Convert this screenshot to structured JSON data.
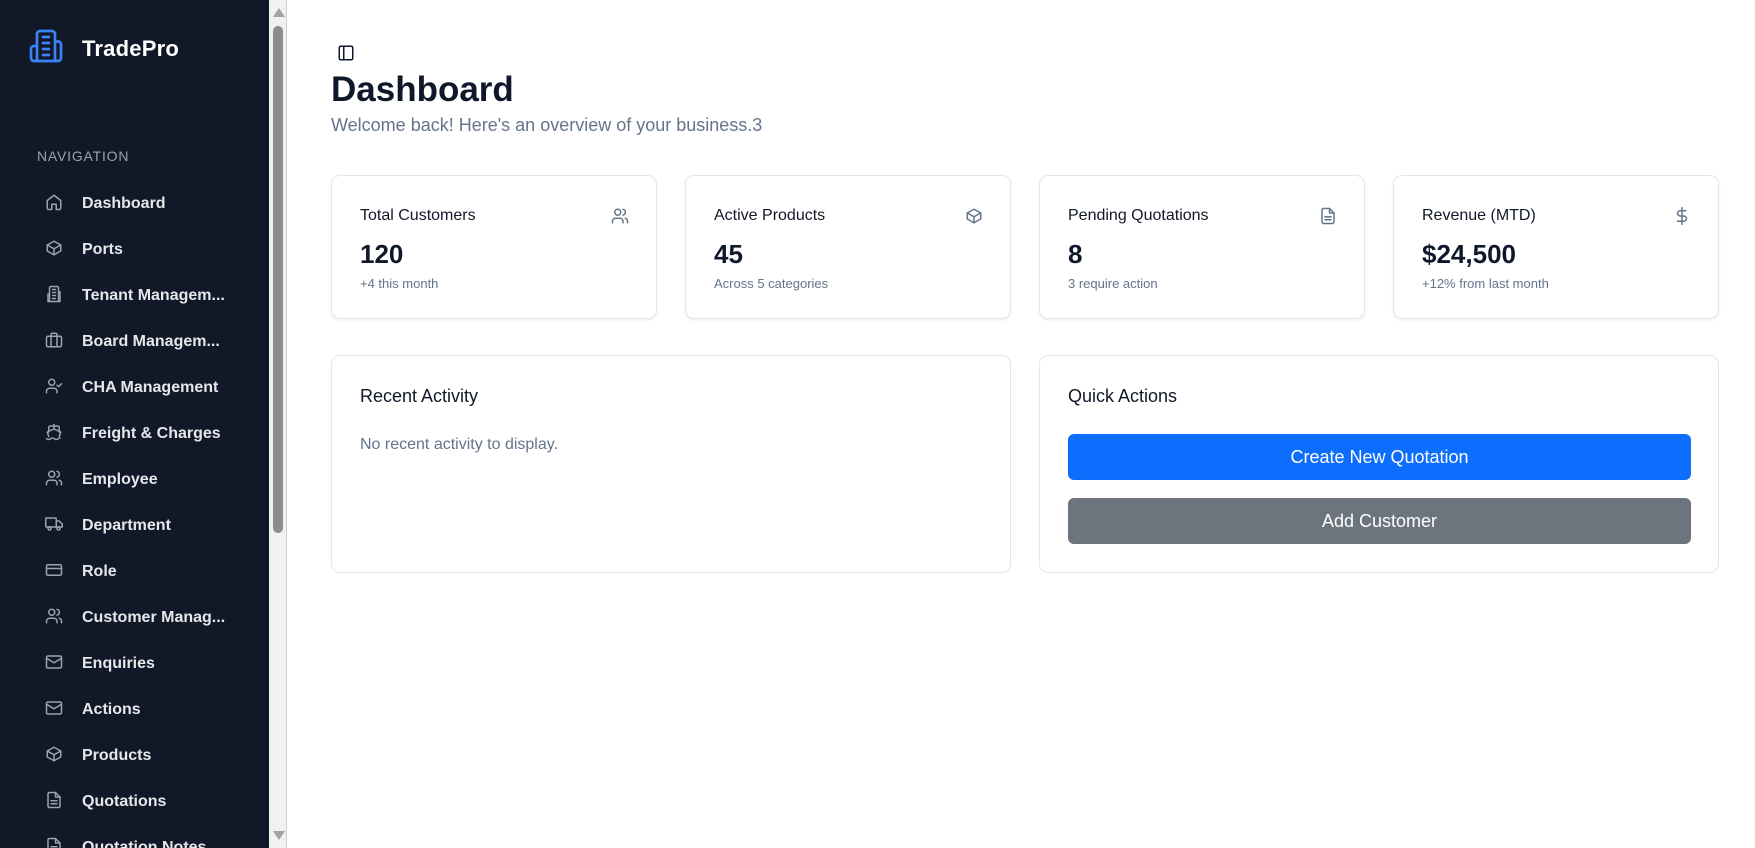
{
  "brand": {
    "name": "TradePro",
    "icon": "building-icon",
    "accent": "#3b82f6"
  },
  "sidebar": {
    "heading": "NAVIGATION",
    "items": [
      {
        "label": "Dashboard",
        "icon": "home-icon"
      },
      {
        "label": "Ports",
        "icon": "package-icon"
      },
      {
        "label": "Tenant Managem...",
        "icon": "building-icon"
      },
      {
        "label": "Board Managem...",
        "icon": "briefcase-icon"
      },
      {
        "label": "CHA Management",
        "icon": "user-check-icon"
      },
      {
        "label": "Freight & Charges",
        "icon": "ship-icon"
      },
      {
        "label": "Employee",
        "icon": "users-icon"
      },
      {
        "label": "Department",
        "icon": "truck-icon"
      },
      {
        "label": "Role",
        "icon": "credit-card-icon"
      },
      {
        "label": "Customer Manag...",
        "icon": "users-icon"
      },
      {
        "label": "Enquiries",
        "icon": "mail-icon"
      },
      {
        "label": "Actions",
        "icon": "mail-icon"
      },
      {
        "label": "Products",
        "icon": "package-icon"
      },
      {
        "label": "Quotations",
        "icon": "file-text-icon"
      },
      {
        "label": "Quotation Notes",
        "icon": "file-text-icon"
      }
    ]
  },
  "header": {
    "title": "Dashboard",
    "subtitle": "Welcome back! Here's an overview of your business.3"
  },
  "stats": [
    {
      "title": "Total Customers",
      "value": "120",
      "sub": "+4 this month",
      "icon": "users-icon"
    },
    {
      "title": "Active Products",
      "value": "45",
      "sub": "Across 5 categories",
      "icon": "package-icon"
    },
    {
      "title": "Pending Quotations",
      "value": "8",
      "sub": "3 require action",
      "icon": "file-text-icon"
    },
    {
      "title": "Revenue (MTD)",
      "value": "$24,500",
      "sub": "+12% from last month",
      "icon": "dollar-icon"
    }
  ],
  "recent_activity": {
    "title": "Recent Activity",
    "empty": "No recent activity to display."
  },
  "quick_actions": {
    "title": "Quick Actions",
    "primary_label": "Create New Quotation",
    "secondary_label": "Add Customer",
    "primary_color": "#0d6efd",
    "secondary_color": "#6c757d"
  }
}
